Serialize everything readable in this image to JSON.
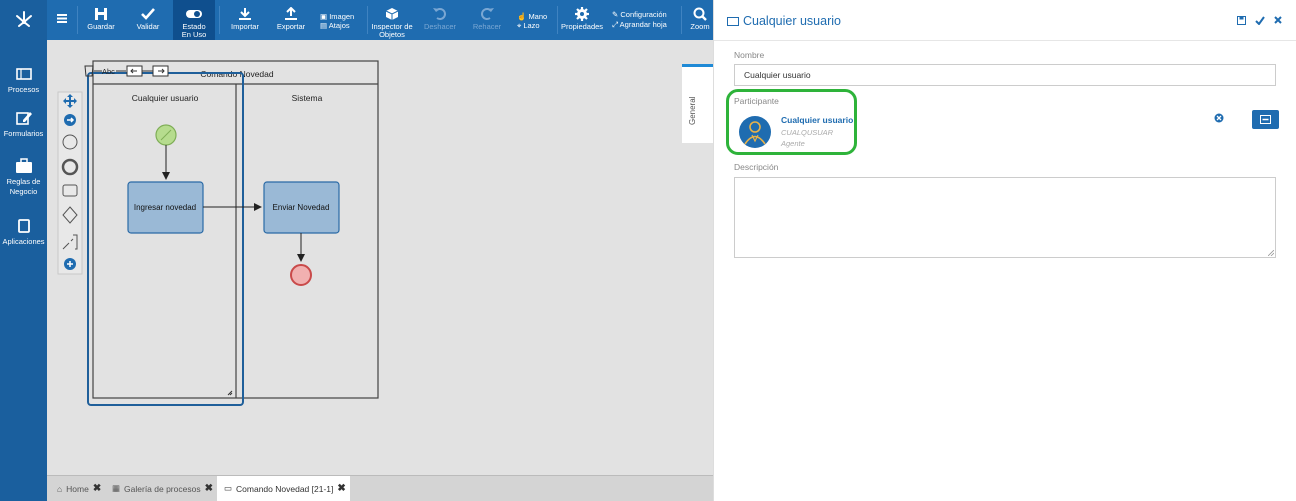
{
  "toolbar": {
    "menu_icon": "hamburger-icon",
    "guardar": "Guardar",
    "validar": "Validar",
    "estado_line1": "Estado",
    "estado_line2": "En Uso",
    "importar": "Importar",
    "exportar": "Exportar",
    "imagen": "Imagen",
    "atajos": "Atajos",
    "inspector_line1": "Inspector de",
    "inspector_line2": "Objetos",
    "deshacer": "Deshacer",
    "rehacer": "Rehacer",
    "mano": "Mano",
    "lazo": "Lazo",
    "propiedades": "Propiedades",
    "configuracion": "Configuración",
    "agrandar": "Agrandar hoja",
    "zoom": "Zoom"
  },
  "leftnav": {
    "procesos": "Procesos",
    "formularios": "Formularios",
    "reglas_line1": "Reglas de",
    "reglas_line2": "Negocio",
    "aplicaciones": "Aplicaciones"
  },
  "diagram": {
    "pool_name": "Comando Novedad",
    "lane_1": "Cualquier usuario",
    "lane_2": "Sistema",
    "task_1": "Ingresar novedad",
    "task_2": "Enviar Novedad",
    "text_tool": "Abc"
  },
  "side_tab": "General",
  "bottom_tabs": [
    {
      "label": "Home"
    },
    {
      "label": "Galería de procesos"
    },
    {
      "label": "Comando Novedad [21-1]"
    }
  ],
  "panel": {
    "title": "Cualquier usuario",
    "nombre_label": "Nombre",
    "nombre_value": "Cualquier usuario",
    "participante_label": "Participante",
    "participant_name": "Cualquier usuario",
    "participant_code": "CUALQUSUAR",
    "participant_type": "Agente",
    "descripcion_label": "Descripción",
    "descripcion_value": ""
  },
  "colors": {
    "nav_bg": "#1a5f9e",
    "toolbar_bg": "#1f6cb0",
    "accent": "#1f6cb0",
    "highlight": "#2eb33a",
    "task_fill": "#9ab9d6",
    "start_event": "#b6dc8e",
    "end_event": "#f1b0b0"
  }
}
